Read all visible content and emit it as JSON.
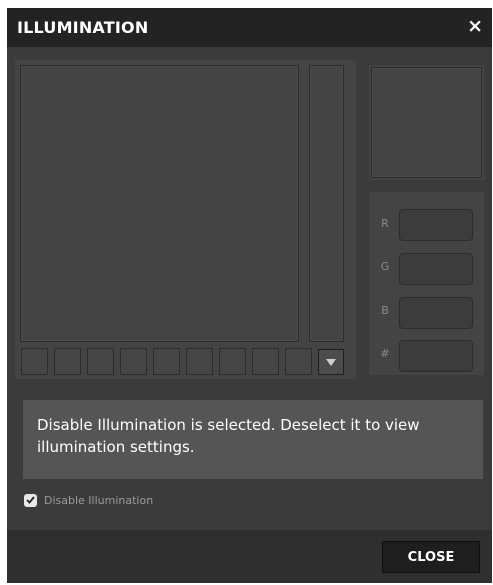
{
  "dialog": {
    "title": "ILLUMINATION",
    "close_icon": "close-icon",
    "close_glyph": "×"
  },
  "color_picker": {
    "swatch_count": 9,
    "dropdown_icon": "triangle-down-icon"
  },
  "rgb": {
    "r_label": "R",
    "g_label": "G",
    "b_label": "B",
    "hex_label": "#",
    "r_value": "",
    "g_value": "",
    "b_value": "",
    "hex_value": ""
  },
  "message": {
    "text": "Disable Illumination is selected. Deselect it to view illumination settings."
  },
  "disable_illumination": {
    "label": "Disable Illumination",
    "checked": true
  },
  "footer": {
    "close_label": "CLOSE"
  },
  "colors": {
    "title_bar": "#232323",
    "body": "#3b3b3b",
    "panel": "#444444",
    "message_bg": "#555555",
    "button_bg": "#1e1e1e"
  }
}
